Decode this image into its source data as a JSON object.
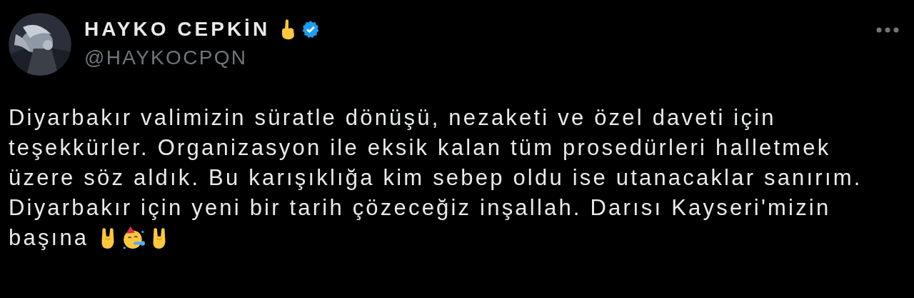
{
  "author": {
    "name": "HAYKO CEPKİN",
    "verified": true,
    "handle": "@HAYKOCPQN"
  },
  "tweet": {
    "text": "Diyarbakır valimizin süratle dönüşü, nezaketi ve özel daveti için\nteşekkürler. Organizasyon ile eksik kalan tüm prosedürleri halletmek\nüzere söz aldık. Bu karışıklığa kim sebep oldu ise utanacaklar sanırım.\nDiyarbakır için yeni bir tarih çözeceğiz inşallah. Darısı Kayseri'mizin",
    "text_end": "başına"
  }
}
